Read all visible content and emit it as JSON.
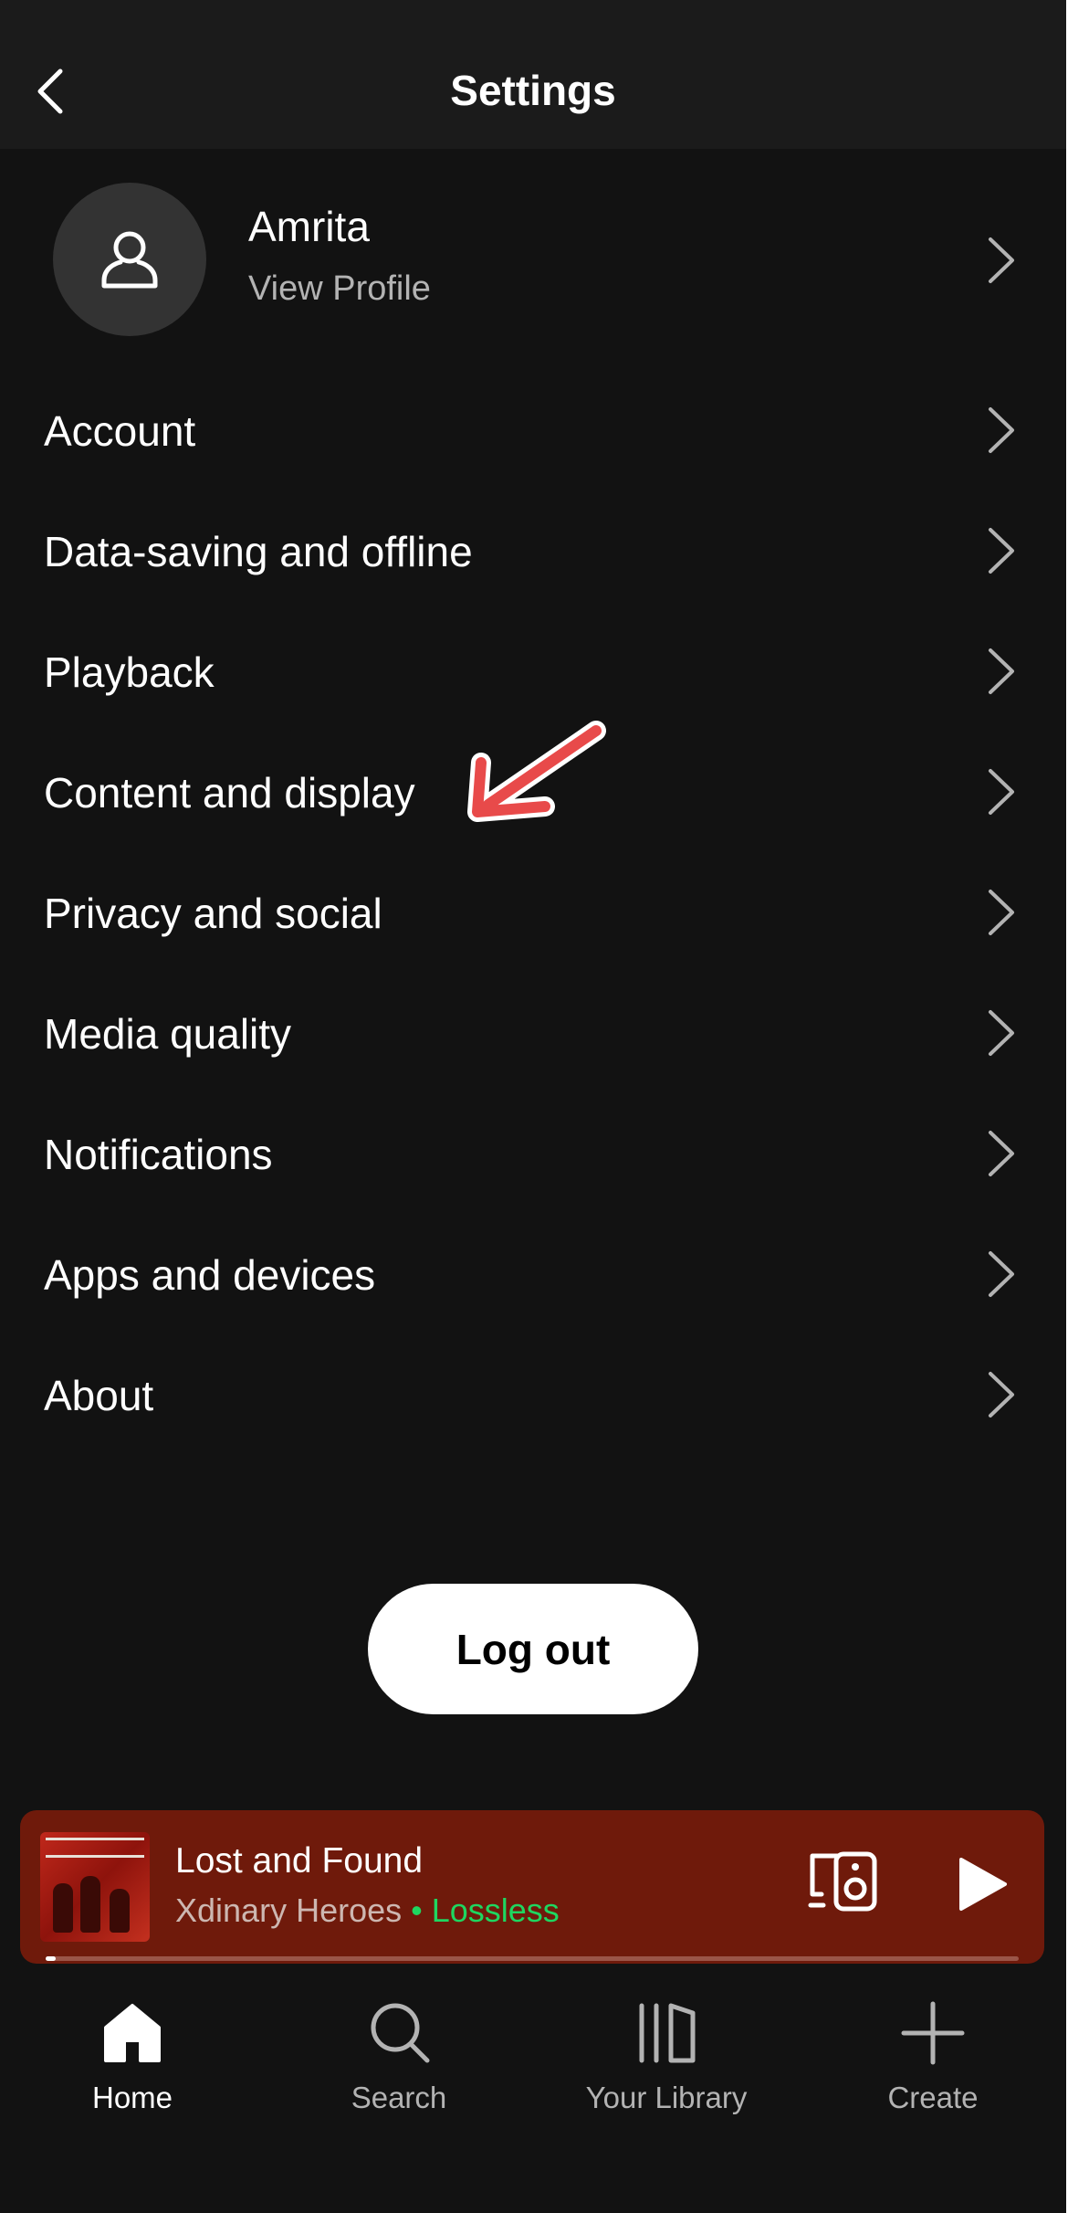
{
  "header": {
    "title": "Settings"
  },
  "profile": {
    "name": "Amrita",
    "subtitle": "View Profile"
  },
  "settings_items": [
    {
      "label": "Account"
    },
    {
      "label": "Data-saving and offline"
    },
    {
      "label": "Playback"
    },
    {
      "label": "Content and display"
    },
    {
      "label": "Privacy and social"
    },
    {
      "label": "Media quality"
    },
    {
      "label": "Notifications"
    },
    {
      "label": "Apps and devices"
    },
    {
      "label": "About"
    }
  ],
  "logout_label": "Log out",
  "now_playing": {
    "title": "Lost and Found",
    "artist": "Xdinary Heroes",
    "separator": " • ",
    "quality": "Lossless",
    "progress_fraction": 0.01
  },
  "bottom_nav": [
    {
      "label": "Home",
      "icon": "home-icon",
      "active": true
    },
    {
      "label": "Search",
      "icon": "search-icon",
      "active": false
    },
    {
      "label": "Your Library",
      "icon": "library-icon",
      "active": false
    },
    {
      "label": "Create",
      "icon": "plus-icon",
      "active": false
    }
  ],
  "colors": {
    "background": "#121212",
    "header": "#1b1b1b",
    "player": "#6f1a0b",
    "accent_green": "#1ed760",
    "annotation_arrow": "#e84a4a"
  }
}
